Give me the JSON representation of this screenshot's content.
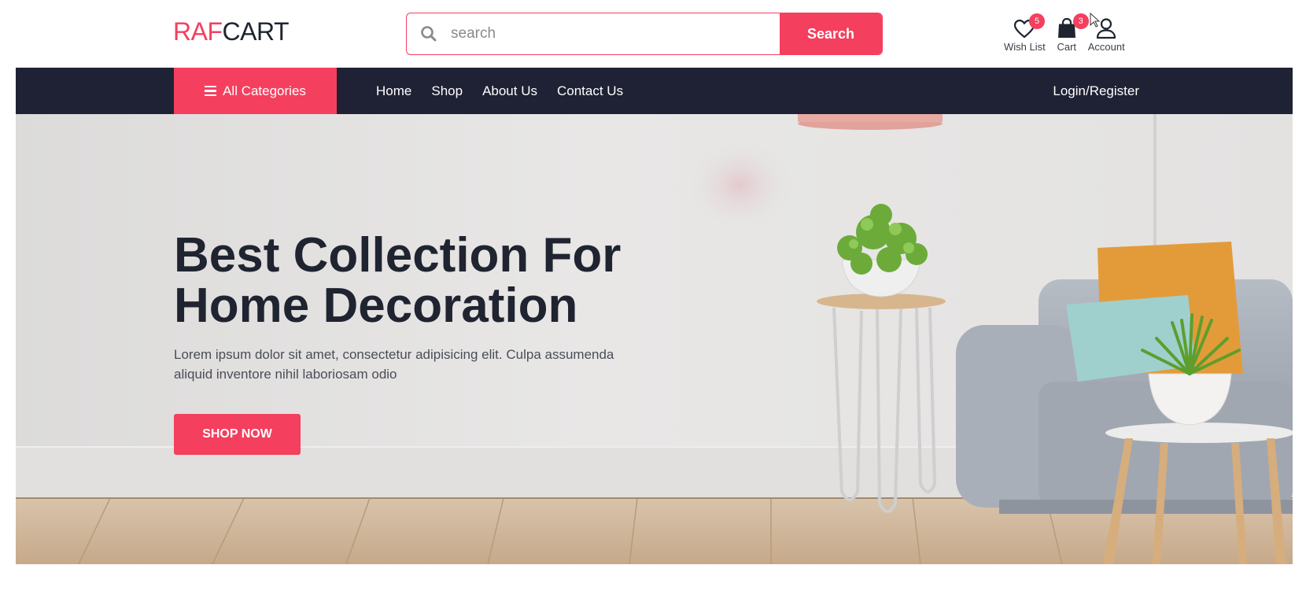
{
  "brand": {
    "logo_part1": "RAF",
    "logo_part2": "CART"
  },
  "search": {
    "placeholder": "search",
    "value": "",
    "button_label": "Search"
  },
  "header_actions": {
    "wishlist": {
      "label": "Wish List",
      "count": "5",
      "icon": "heart-icon"
    },
    "cart": {
      "label": "Cart",
      "count": "3",
      "icon": "shopping-bag-icon"
    },
    "account": {
      "label": "Account",
      "icon": "user-icon"
    }
  },
  "nav": {
    "categories_label": "All Categories",
    "links": [
      "Home",
      "Shop",
      "About Us",
      "Contact Us"
    ],
    "login_label": "Login/Register"
  },
  "hero": {
    "title_line1": "Best Collection For",
    "title_line2": "Home Decoration",
    "description": "Lorem ipsum dolor sit amet, consectetur adipisicing elit. Culpa assumenda aliquid inventore nihil laboriosam odio",
    "cta_label": "SHOP NOW"
  },
  "colors": {
    "accent": "#f43f5e",
    "navbar": "#1f2235",
    "text_dark": "#1f2430"
  }
}
